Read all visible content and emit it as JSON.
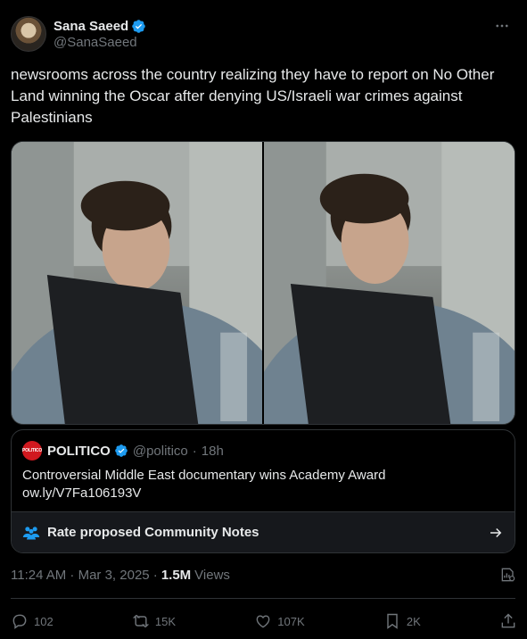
{
  "author": {
    "display_name": "Sana Saeed",
    "handle": "@SanaSaeed"
  },
  "tweet": {
    "text": "newsrooms across the country realizing they have to report on No Other Land winning the Oscar after denying US/Israeli war crimes against Palestinians"
  },
  "quote": {
    "logo_text": "POLITICO",
    "name": "POLITICO",
    "handle": "@politico",
    "separator": "·",
    "age": "18h",
    "text": "Controversial Middle East documentary wins Academy Award ow.ly/V7Fa106193V"
  },
  "community_notes": {
    "label": "Rate proposed Community Notes"
  },
  "meta": {
    "time": "11:24 AM · Mar 3, 2025 ·",
    "views_count": "1.5M",
    "views_label": "Views"
  },
  "actions": {
    "replies": "102",
    "reposts": "15K",
    "likes": "107K",
    "bookmarks": "2K"
  },
  "colors": {
    "background": "#000000",
    "text": "#e7e9ea",
    "secondary": "#71767b",
    "verified": "#1d9bf0",
    "politico_red": "#d1191f",
    "border": "#2f3336"
  },
  "icons": {
    "verified": "verified-badge-icon",
    "more": "more-icon",
    "notes": "community-notes-icon",
    "arrow": "arrow-right-icon",
    "analytics": "grok-analytics-icon",
    "reply": "reply-icon",
    "repost": "repost-icon",
    "like": "like-icon",
    "bookmark": "bookmark-icon",
    "share": "share-icon"
  }
}
